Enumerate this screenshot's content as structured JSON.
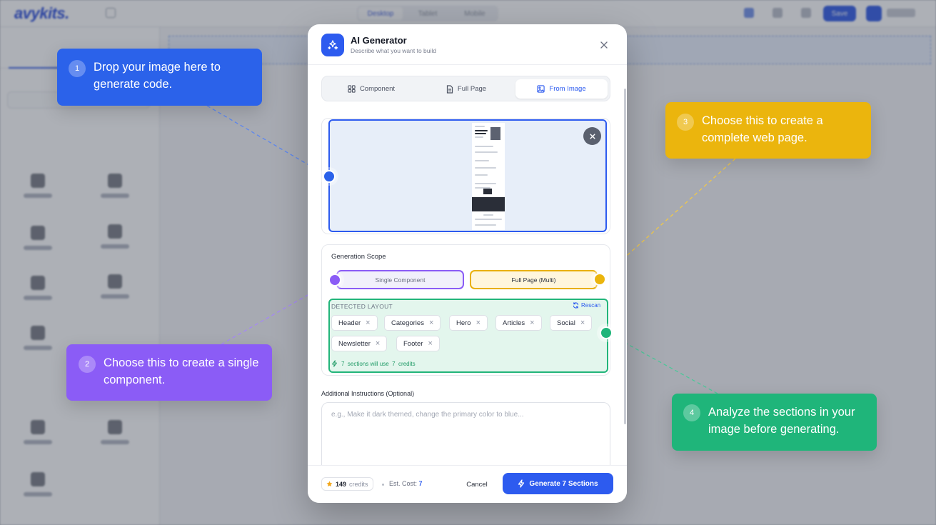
{
  "background": {
    "logo_text": "avykits.",
    "top_tabs": [
      "Desktop",
      "Tablet",
      "Mobile"
    ],
    "save_label": "Save"
  },
  "modal": {
    "title": "AI Generator",
    "subtitle": "Describe what you want to build",
    "tabs": [
      {
        "label": "Component",
        "icon": "component-grid-icon",
        "active": false
      },
      {
        "label": "Full Page",
        "icon": "document-icon",
        "active": false
      },
      {
        "label": "From Image",
        "icon": "image-icon",
        "active": true
      }
    ],
    "scope": {
      "label": "Generation Scope",
      "options": [
        {
          "label": "Single Component",
          "selected": false
        },
        {
          "label": "Full Page (Multi)",
          "selected": true
        }
      ]
    },
    "detected_layout": {
      "title": "DETECTED LAYOUT",
      "rescan_label": "Rescan",
      "sections": [
        "Header",
        "Categories",
        "Hero",
        "Articles",
        "Social",
        "Newsletter",
        "Footer"
      ],
      "credits_note": "7  sections will use  7  credits"
    },
    "instructions": {
      "label": "Additional Instructions (Optional)",
      "placeholder": "e.g., Make it dark themed, change the primary color to blue...",
      "value": ""
    },
    "footer": {
      "credits_value": "149",
      "credits_unit": "credits",
      "est_cost_label": "Est. Cost:",
      "est_cost_value": "7",
      "cancel_label": "Cancel",
      "generate_label": "Generate 7 Sections"
    }
  },
  "callouts": [
    {
      "number": "1",
      "text": "Drop your image here to generate code.",
      "color": "#2b62ea"
    },
    {
      "number": "2",
      "text": "Choose this to create a single component.",
      "color": "#8b5cf6"
    },
    {
      "number": "3",
      "text": "Choose this to create a complete web page.",
      "color": "#ebb50d"
    },
    {
      "number": "4",
      "text": "Analyze the sections in your image before generating.",
      "color": "#1fb57a"
    }
  ],
  "colors": {
    "primary": "#2d5bef",
    "purple": "#8b5cf6",
    "amber": "#e9b008",
    "green": "#22b57a"
  }
}
